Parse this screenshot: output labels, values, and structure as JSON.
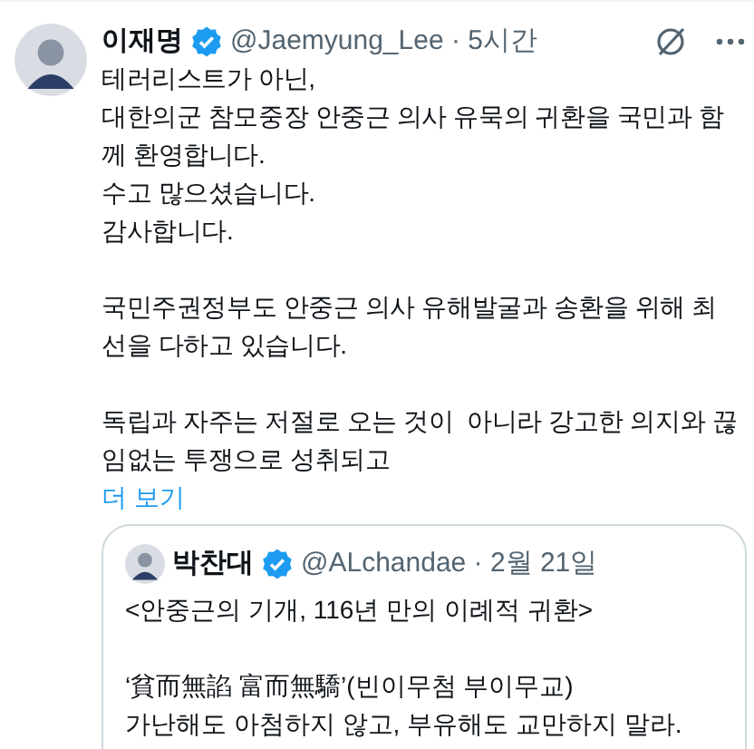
{
  "post": {
    "author": {
      "name": "이재명",
      "verified": true,
      "meta": "@Jaemyung_Lee · 5시간"
    },
    "paragraphs": [
      [
        "테러리스트가 아닌,",
        "대한의군 참모중장 안중근 의사 유묵의 귀환을 국민과 함",
        "께 환영합니다.",
        "수고 많으셨습니다.",
        "감사합니다."
      ],
      [
        "국민주권정부도 안중근 의사 유해발굴과 송환을 위해 최",
        "선을 다하고 있습니다."
      ],
      [
        "독립과 자주는 저절로 오는 것이  아니라 강고한 의지와 끊",
        "임없는 투쟁으로 성취되고"
      ]
    ],
    "more_link": "더 보기",
    "quote": {
      "author": {
        "name": "박찬대",
        "verified": true,
        "meta": "@ALchandae · 2월 21일"
      },
      "paragraphs": [
        [
          "<안중근의 기개, 116년 만의 이례적 귀환>"
        ],
        [
          "‘貧而無諂 富而無驕’(빈이무첨 부이무교)",
          "가난해도 아첨하지 않고, 부유해도 교만하지 말라."
        ]
      ]
    }
  }
}
